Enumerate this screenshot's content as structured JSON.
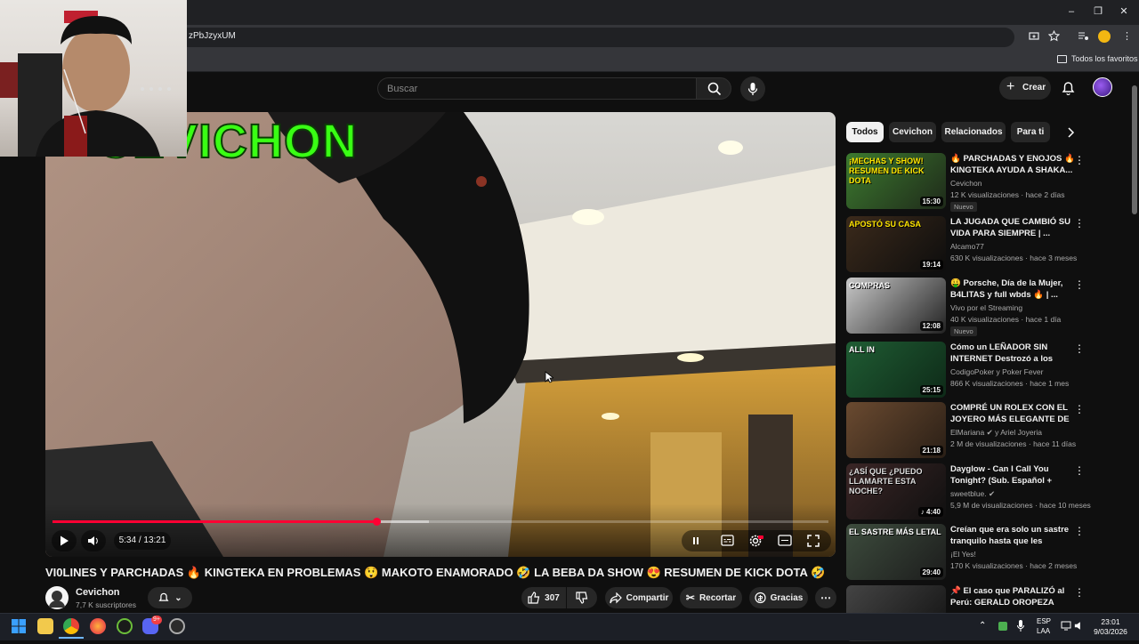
{
  "browser": {
    "url_fragment": "zPbJzyxUM",
    "bookmarks_label": "Todos los favoritos"
  },
  "youtube": {
    "search_placeholder": "Buscar",
    "create_label": "Crear"
  },
  "player": {
    "overlay_text": "CEVICHON",
    "time": "5:34 / 13:21",
    "progress_fraction": 0.418,
    "buffered_fraction": 0.485
  },
  "video": {
    "title": "VI0LINES Y PARCHADAS 🔥 KINGTEKA EN PROBLEMAS 😲 MAKOTO ENAMORADO 🤣 LA BEBA DA SHOW 😍 RESUMEN DE KICK DOTA 🤣",
    "channel": "Cevichon",
    "subscribers": "7,7 K suscriptores",
    "likes": "307",
    "share_label": "Compartir",
    "clip_label": "Recortar",
    "thanks_label": "Gracias"
  },
  "chips": [
    "Todos",
    "Cevichon",
    "Relacionados",
    "Para ti"
  ],
  "recommendations": [
    {
      "title": "🔥 PARCHADAS Y ENOJOS 🔥 KINGTEKA AYUDA A SHAKA...",
      "channel": "Cevichon",
      "meta": "12 K visualizaciones · hace 2 días",
      "badge": "Nuevo",
      "duration": "15:30",
      "thumb_text": "¡MECHAS Y SHOW! RESUMEN DE KICK DOTA"
    },
    {
      "title": "LA JUGADA QUE CAMBIÓ SU VIDA PARA SIEMPRE | ...",
      "channel": "Alcamo77",
      "meta": "630 K visualizaciones · hace 3 meses",
      "badge": "",
      "duration": "19:14",
      "thumb_text": "APOSTÓ SU CASA"
    },
    {
      "title": "🤑 Porsche, Día de la Mujer, B4LITAS y full wbds 🔥 | ...",
      "channel": "Vivo por el Streaming",
      "meta": "40 K visualizaciones · hace 1 día",
      "badge": "Nuevo",
      "duration": "12:08",
      "thumb_text": "COMPRAS"
    },
    {
      "title": "Cómo un LEÑADOR SIN INTERNET Destrozó a los Pros...",
      "channel": "CodigoPoker y Poker Fever",
      "meta": "866 K visualizaciones · hace 1 mes",
      "badge": "",
      "duration": "25:15",
      "thumb_text": "ALL IN"
    },
    {
      "title": "COMPRÉ UN ROLEX CON EL JOYERO MÁS ELEGANTE DE ...",
      "channel": "ElMariana ✔ y Ariel Joyeria",
      "meta": "2 M de visualizaciones · hace 11 días",
      "badge": "",
      "duration": "21:18",
      "thumb_text": ""
    },
    {
      "title": "Dayglow - Can I Call You Tonight? (Sub. Español + Lyric...",
      "channel": "sweetblue. ✔",
      "meta": "5,9 M de visualizaciones · hace 10 meses",
      "badge": "",
      "duration": "♪ 4:40",
      "thumb_text": "¿ASÍ QUE ¿PUEDO LLAMARTE ESTA NOCHE?"
    },
    {
      "title": "Creían que era solo un sastre tranquilo hasta que les mostró...",
      "channel": "¡El Yes!",
      "meta": "170 K visualizaciones · hace 2 meses",
      "badge": "",
      "duration": "29:40",
      "thumb_text": "EL SASTRE MÁS LETAL"
    },
    {
      "title": "📌 El caso que PARALIZÓ al Perú: GERALD OROPEZA",
      "channel": "",
      "meta": "",
      "badge": "",
      "duration": "",
      "thumb_text": ""
    }
  ],
  "taskbar": {
    "lang": "ESP",
    "lang_sub": "LAA",
    "time": "23:01",
    "date": "9/03/2026",
    "discord_badge": "9+"
  },
  "colors": {
    "accent_red": "#ff0033",
    "background": "#0f0f0f",
    "overlay_green": "#39ff14"
  }
}
